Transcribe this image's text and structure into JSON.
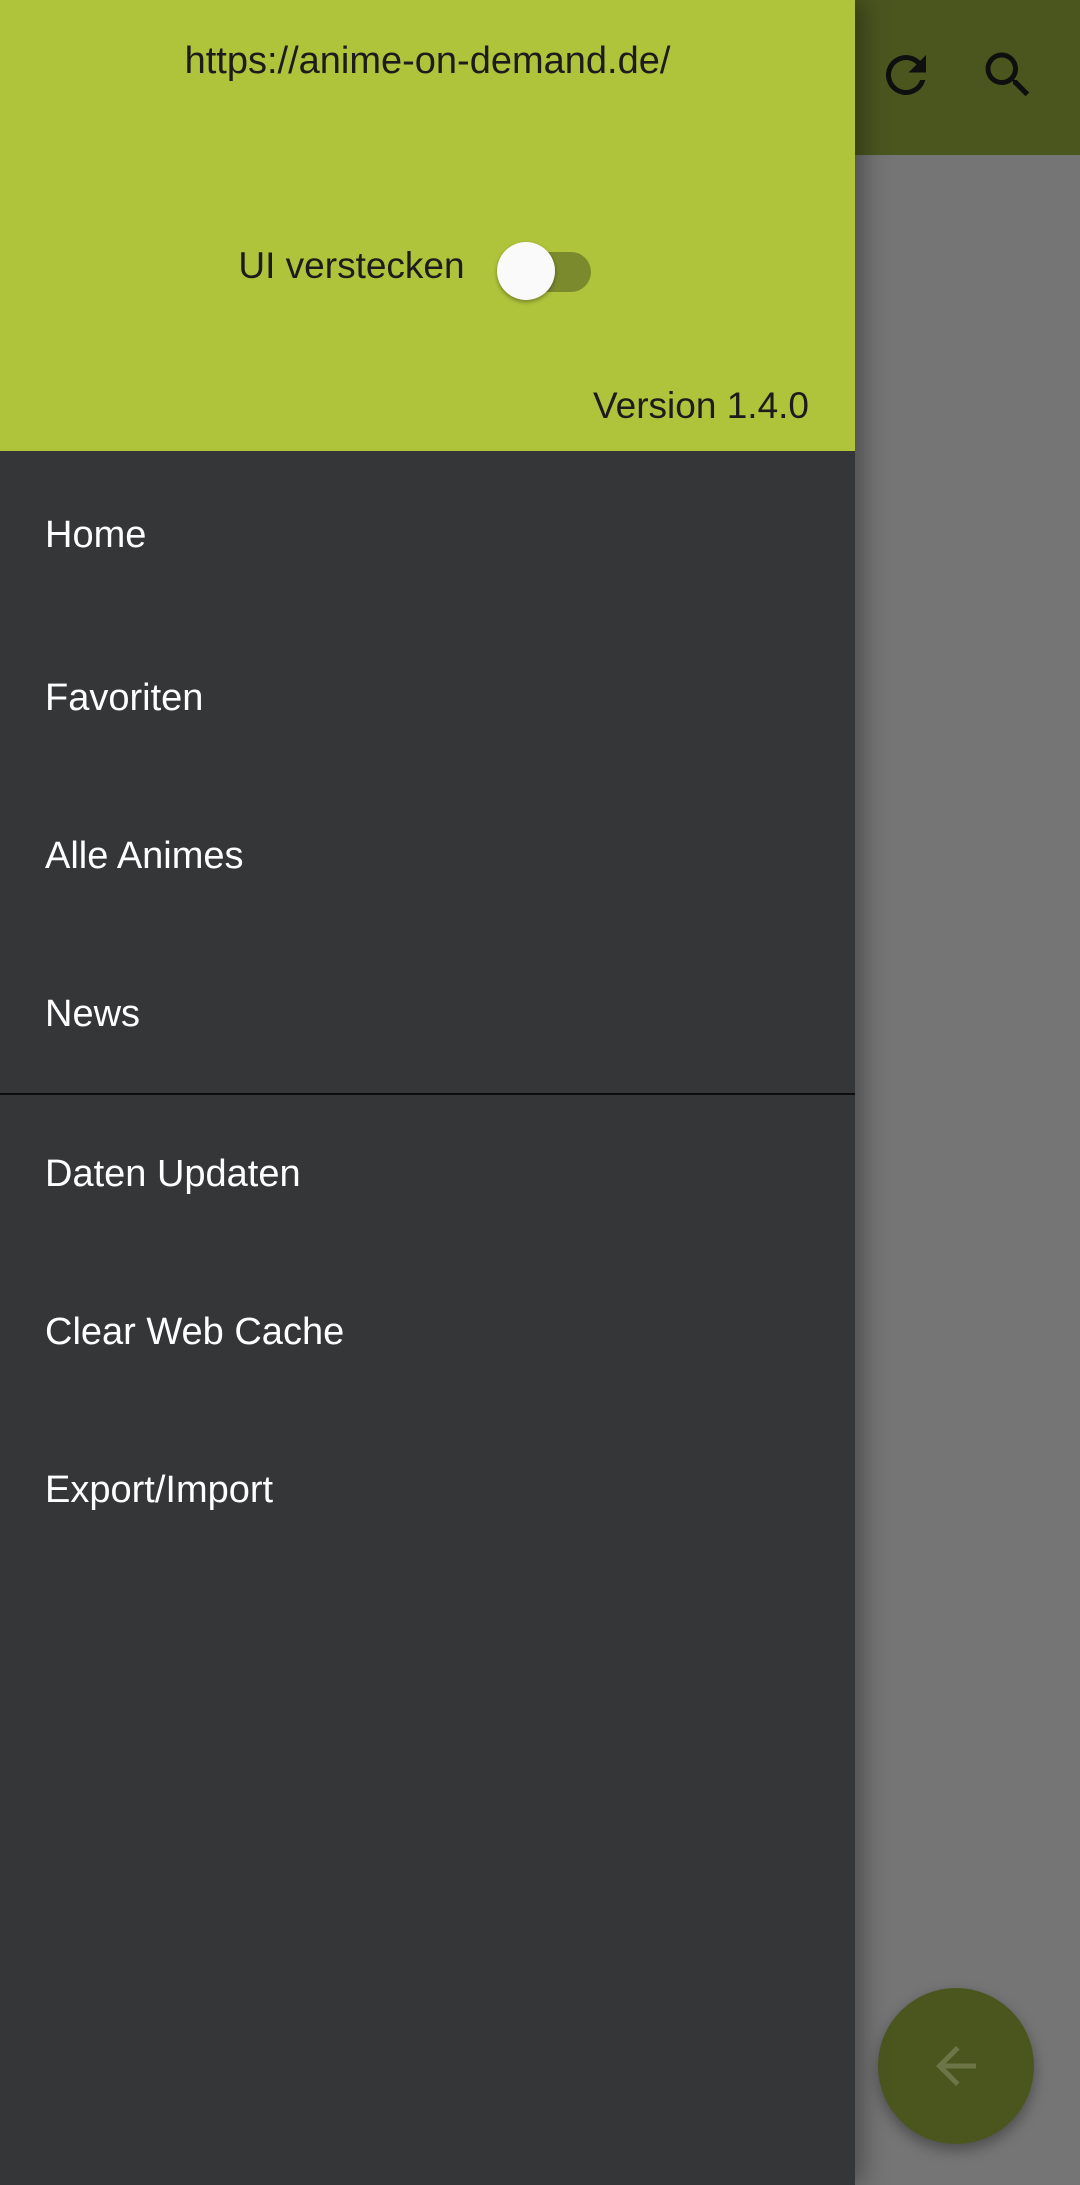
{
  "appbar": {
    "actions": [
      {
        "icon": "refresh-icon"
      },
      {
        "icon": "search-icon"
      }
    ]
  },
  "fab": {
    "icon": "arrow-back-icon"
  },
  "drawer": {
    "url": "https://anime-on-demand.de/",
    "toggle_label": "UI verstecken",
    "toggle_on": false,
    "version": "Version 1.4.0",
    "items": [
      {
        "label": "Home"
      },
      {
        "label": "Favoriten"
      },
      {
        "label": "Alle Animes"
      },
      {
        "label": "News"
      }
    ],
    "items_secondary": [
      {
        "label": "Daten Updaten"
      },
      {
        "label": "Clear Web Cache"
      },
      {
        "label": "Export/Import"
      }
    ]
  },
  "colors": {
    "header": "#b0c43b",
    "drawer_bg": "#353638",
    "appbar_dimmed": "#4b561f",
    "scrim_bg": "#757575"
  }
}
